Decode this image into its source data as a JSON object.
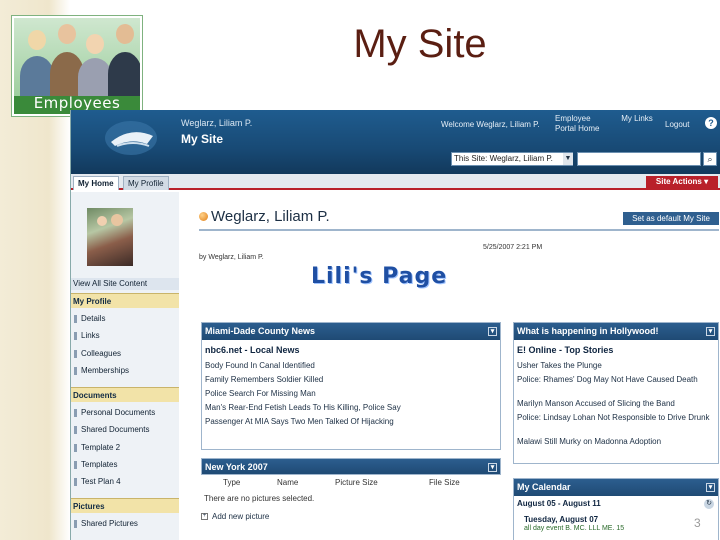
{
  "slide": {
    "title": "My Site",
    "logo_label": "Employees",
    "number": "3"
  },
  "header": {
    "user_name": "Weglarz, Liliam P.",
    "site_title": "My Site",
    "welcome": "Welcome Weglarz, Liliam P.",
    "top_links": [
      "Employee Portal Home",
      "My Links"
    ],
    "logout": "Logout",
    "help": "?",
    "search_scope": "This Site: Weglarz, Liliam P."
  },
  "tabs": {
    "my_home": "My Home",
    "my_profile": "My Profile",
    "site_actions": "Site Actions"
  },
  "left_nav": {
    "view_all": "View All Site Content",
    "profile_heading": "My Profile",
    "profile_items": [
      "Details",
      "Links",
      "Colleagues",
      "Memberships"
    ],
    "documents_heading": "Documents",
    "document_items": [
      "Personal Documents",
      "Shared Documents",
      "Template 2",
      "Templates",
      "Test Plan 4"
    ],
    "pictures_heading": "Pictures",
    "picture_items": [
      "Shared Pictures"
    ]
  },
  "main": {
    "page_title": "Weglarz, Liliam P.",
    "set_default": "Set as default My Site",
    "by_line": "by Weglarz, Liliam P.",
    "date": "5/25/2007 2:21 PM",
    "banner": "Lili's Page"
  },
  "miami_news": {
    "title": "Miami-Dade County News",
    "source": "nbc6.net - Local News",
    "items": [
      "Body Found In Canal Identified",
      "Family Remembers Soldier Killed",
      "Police Search For Missing Man",
      "Man's Rear-End Fetish Leads To His Killing, Police Say",
      "Passenger At MIA Says Two Men Talked Of Hijacking"
    ]
  },
  "hollywood": {
    "title": "What is happening in Hollywood!",
    "source": "E! Online - Top Stories",
    "items": [
      "Usher Takes the Plunge",
      "Police: Rhames' Dog May Not Have Caused Death",
      "Marilyn Manson Accused of Slicing the Band",
      "Police: Lindsay Lohan Not Responsible to Drive Drunk",
      "Malawi Still Murky on Madonna Adoption"
    ]
  },
  "pictures": {
    "title": "New York 2007",
    "columns": [
      "Type",
      "Name",
      "Picture Size",
      "File Size"
    ],
    "empty": "There are no pictures selected.",
    "add": "Add new picture"
  },
  "calendar": {
    "title": "My Calendar",
    "range": "August 05 - August 11",
    "day": "Tuesday, August 07",
    "event": "all day event    B. MC. LLL ME. 15"
  }
}
